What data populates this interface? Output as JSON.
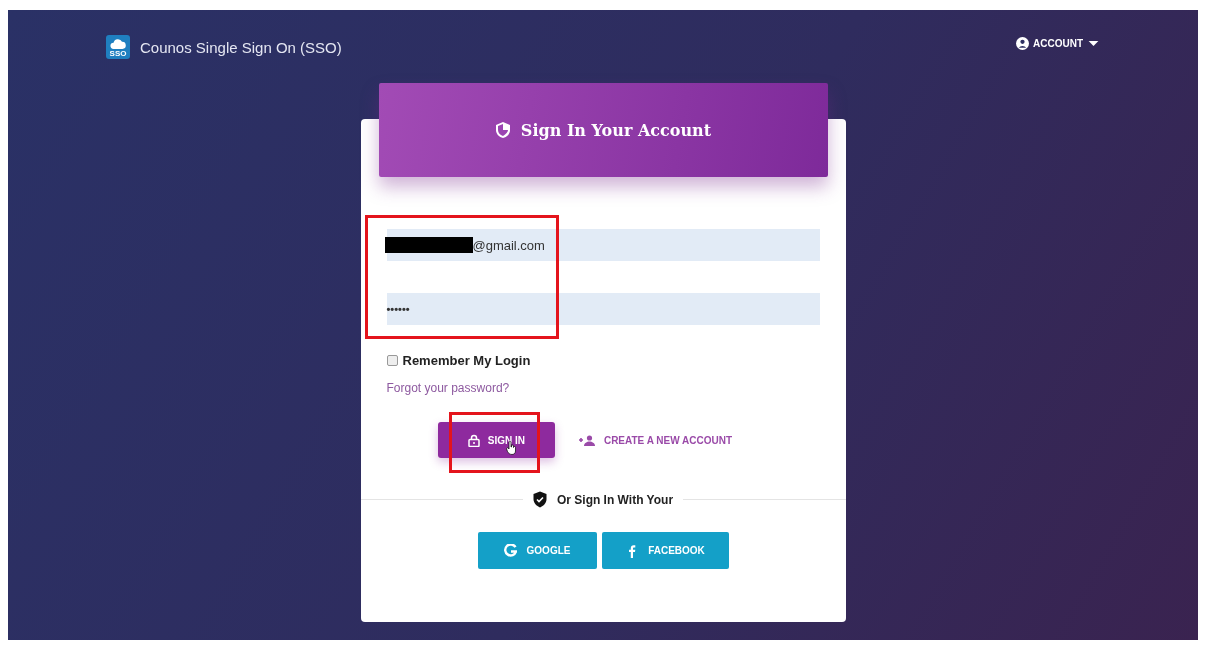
{
  "header": {
    "brand": "Counos Single Sign On (SSO)",
    "logo_text": "SSO",
    "account_menu": "ACCOUNT"
  },
  "login_form": {
    "title": "Sign In Your Account",
    "highlighted": true,
    "fields": [
      {
        "kind": "email",
        "value": "@gmail.com",
        "redacted": true
      },
      {
        "kind": "password",
        "value": "••••••",
        "redacted": false
      }
    ],
    "remember": {
      "label": "Remember My Login",
      "checked": false
    },
    "forgot_link": "Forgot your password?",
    "sign_in": {
      "label": "SIGN IN",
      "highlighted": true,
      "hovered": true
    },
    "create_account": "CREATE A NEW ACCOUNT",
    "divider_text": "Or Sign In With Your",
    "social": [
      {
        "kind": "google",
        "label": "GOOGLE"
      },
      {
        "kind": "facebook",
        "label": "FACEBOOK"
      }
    ]
  }
}
